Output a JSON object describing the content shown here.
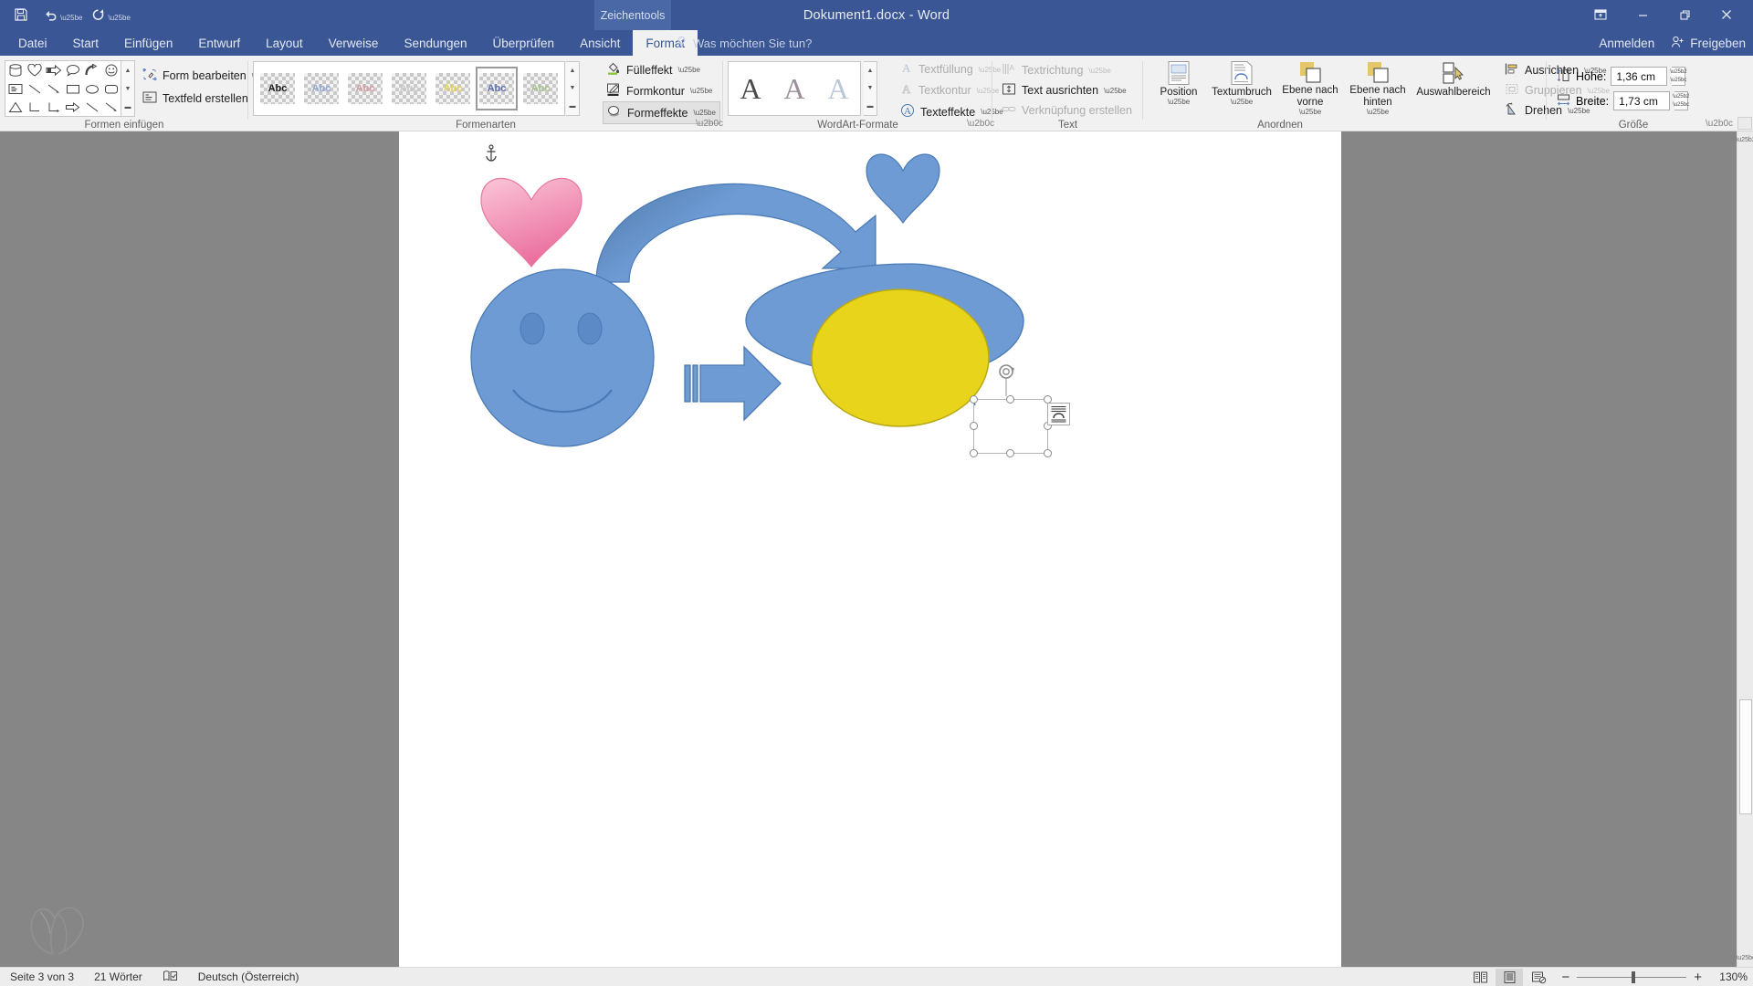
{
  "window": {
    "title": "Dokument1.docx - Word",
    "contextual_tab_label": "Zeichentools",
    "minimize": "–",
    "restore": "❐",
    "close": "✕",
    "ribbon_display_options": "ribbon-display-options-icon"
  },
  "quick_access": {
    "save": "save-icon",
    "undo": "undo-icon",
    "redo": "redo-icon",
    "more": "more-icon"
  },
  "tabs": [
    {
      "label": "Datei",
      "active": false
    },
    {
      "label": "Start",
      "active": false
    },
    {
      "label": "Einfügen",
      "active": false
    },
    {
      "label": "Entwurf",
      "active": false
    },
    {
      "label": "Layout",
      "active": false
    },
    {
      "label": "Verweise",
      "active": false
    },
    {
      "label": "Sendungen",
      "active": false
    },
    {
      "label": "Überprüfen",
      "active": false
    },
    {
      "label": "Ansicht",
      "active": false
    },
    {
      "label": "Format",
      "active": true
    }
  ],
  "tell_me": {
    "placeholder": "Was möchten Sie tun?",
    "icon": "lightbulb-icon"
  },
  "account": {
    "sign_in": "Anmelden",
    "share": "Freigeben",
    "share_icon": "share-person-icon"
  },
  "ribbon": {
    "groups": [
      {
        "name": "insert-shapes",
        "label": "Formen einfügen"
      },
      {
        "name": "shape-styles",
        "label": "Formenarten"
      },
      {
        "name": "wordart-styles",
        "label": "WordArt-Formate"
      },
      {
        "name": "text",
        "label": "Text"
      },
      {
        "name": "arrange",
        "label": "Anordnen"
      },
      {
        "name": "size",
        "label": "Größe"
      }
    ],
    "insert_shapes": {
      "edit_shape": "Form bearbeiten",
      "draw_textbox": "Textfeld erstellen",
      "gallery_rows": [
        [
          "cylinder-shape",
          "heart-shape",
          "striped-right-arrow-shape",
          "speech-bubble-shape",
          "curved-arrow-shape",
          "smiley-face-shape"
        ],
        [
          "text-box-shape",
          "line-shape",
          "line-arrow-shape",
          "rectangle-shape",
          "oval-shape",
          "rounded-rectangle-shape"
        ],
        [
          "triangle-shape",
          "elbow-connector-shape",
          "elbow-arrow-connector-shape",
          "right-arrow-shape",
          "line-shape-2",
          "line-arrow-shape-2"
        ]
      ],
      "scroll_up": "▲",
      "scroll_down": "▼",
      "scroll_more": "▬"
    },
    "shape_styles": {
      "thumbs": [
        {
          "text": "Abc",
          "color": "#1a1a1a",
          "selected": false
        },
        {
          "text": "Abc",
          "color": "#8fa8d8",
          "selected": false
        },
        {
          "text": "Abc",
          "color": "#d79aa2",
          "selected": false
        },
        {
          "text": "Abc",
          "color": "#c9c9c9",
          "selected": false
        },
        {
          "text": "Abc",
          "color": "#e4cf62",
          "selected": false
        },
        {
          "text": "Abc",
          "color": "#5b6fb5",
          "selected": true
        },
        {
          "text": "Abc",
          "color": "#a7c08a",
          "selected": false
        }
      ],
      "fill": "Fülleffekt",
      "outline": "Formkontur",
      "effects": "Formeffekte",
      "scroll_up": "▲",
      "scroll_down": "▼",
      "scroll_more": "▬"
    },
    "wordart_styles": {
      "thumbs": [
        {
          "letter": "A",
          "color": "#4b4b4b"
        },
        {
          "letter": "A",
          "color": "#9a8f9a"
        },
        {
          "letter": "A",
          "color": "#b9c7d9"
        }
      ],
      "text_fill": "Textfüllung",
      "text_outline": "Textkontur",
      "text_effects": "Texteffekte",
      "scroll_up": "▲",
      "scroll_down": "▼",
      "scroll_more": "▬"
    },
    "text_group": {
      "text_direction": "Textrichtung",
      "align_text": "Text ausrichten",
      "create_link": "Verknüpfung erstellen"
    },
    "arrange": {
      "position": "Position",
      "wrap_text": "Textumbruch",
      "bring_forward": "Ebene nach vorne",
      "send_backward": "Ebene nach hinten",
      "selection_pane": "Auswahlbereich",
      "align": "Ausrichten",
      "group": "Gruppieren",
      "rotate": "Drehen"
    },
    "size": {
      "height_label": "Höhe:",
      "height_value": "1,36  cm",
      "width_label": "Breite:",
      "width_value": "1,73  cm",
      "dialog_launcher": "dialog-launcher-icon"
    },
    "collapse_ribbon": "∧"
  },
  "document": {
    "anchor": "anchor-icon",
    "shapes": [
      {
        "name": "pink-heart-shape",
        "type": "heart",
        "fill": "#f0a3c0",
        "stroke": "#e07ba6"
      },
      {
        "name": "blue-heart-shape",
        "type": "heart",
        "fill": "#6e9bd4",
        "stroke": "#4a7ab5"
      },
      {
        "name": "curved-arrow-shape",
        "type": "curved-arrow",
        "fill": "#6e9bd4",
        "stroke": "#4a7ab5"
      },
      {
        "name": "smiley-face-shape",
        "type": "smiley",
        "fill": "#6e9bd4",
        "stroke": "#4a7ab5"
      },
      {
        "name": "speech-bubble-shape",
        "type": "speech-bubble",
        "fill": "#6e9bd4",
        "stroke": "#4a7ab5"
      },
      {
        "name": "striped-right-arrow-shape",
        "type": "striped-arrow",
        "fill": "#6e9bd4",
        "stroke": "#4a7ab5"
      },
      {
        "name": "yellow-oval-shape",
        "type": "oval",
        "fill": "#e8d41a",
        "stroke": "#b8a814"
      },
      {
        "name": "selected-empty-shape",
        "type": "selected-rect",
        "fill": "none",
        "stroke": "#9a9a9a"
      }
    ],
    "selection": {
      "rotate_handle": "rotate-handle-icon",
      "layout_options": "layout-options-icon"
    },
    "watermark": "butterfly-watermark-icon"
  },
  "status_bar": {
    "page": "Seite 3 von 3",
    "words": "21 Wörter",
    "proofing_icon": "proofing-icon",
    "language": "Deutsch (Österreich)",
    "views": [
      {
        "name": "read-mode-view",
        "icon": "read-mode-icon",
        "active": false
      },
      {
        "name": "print-layout-view",
        "icon": "print-layout-icon",
        "active": true
      },
      {
        "name": "web-layout-view",
        "icon": "web-layout-icon",
        "active": false
      }
    ],
    "zoom_out": "−",
    "zoom_in": "+",
    "zoom_level": "130%"
  }
}
